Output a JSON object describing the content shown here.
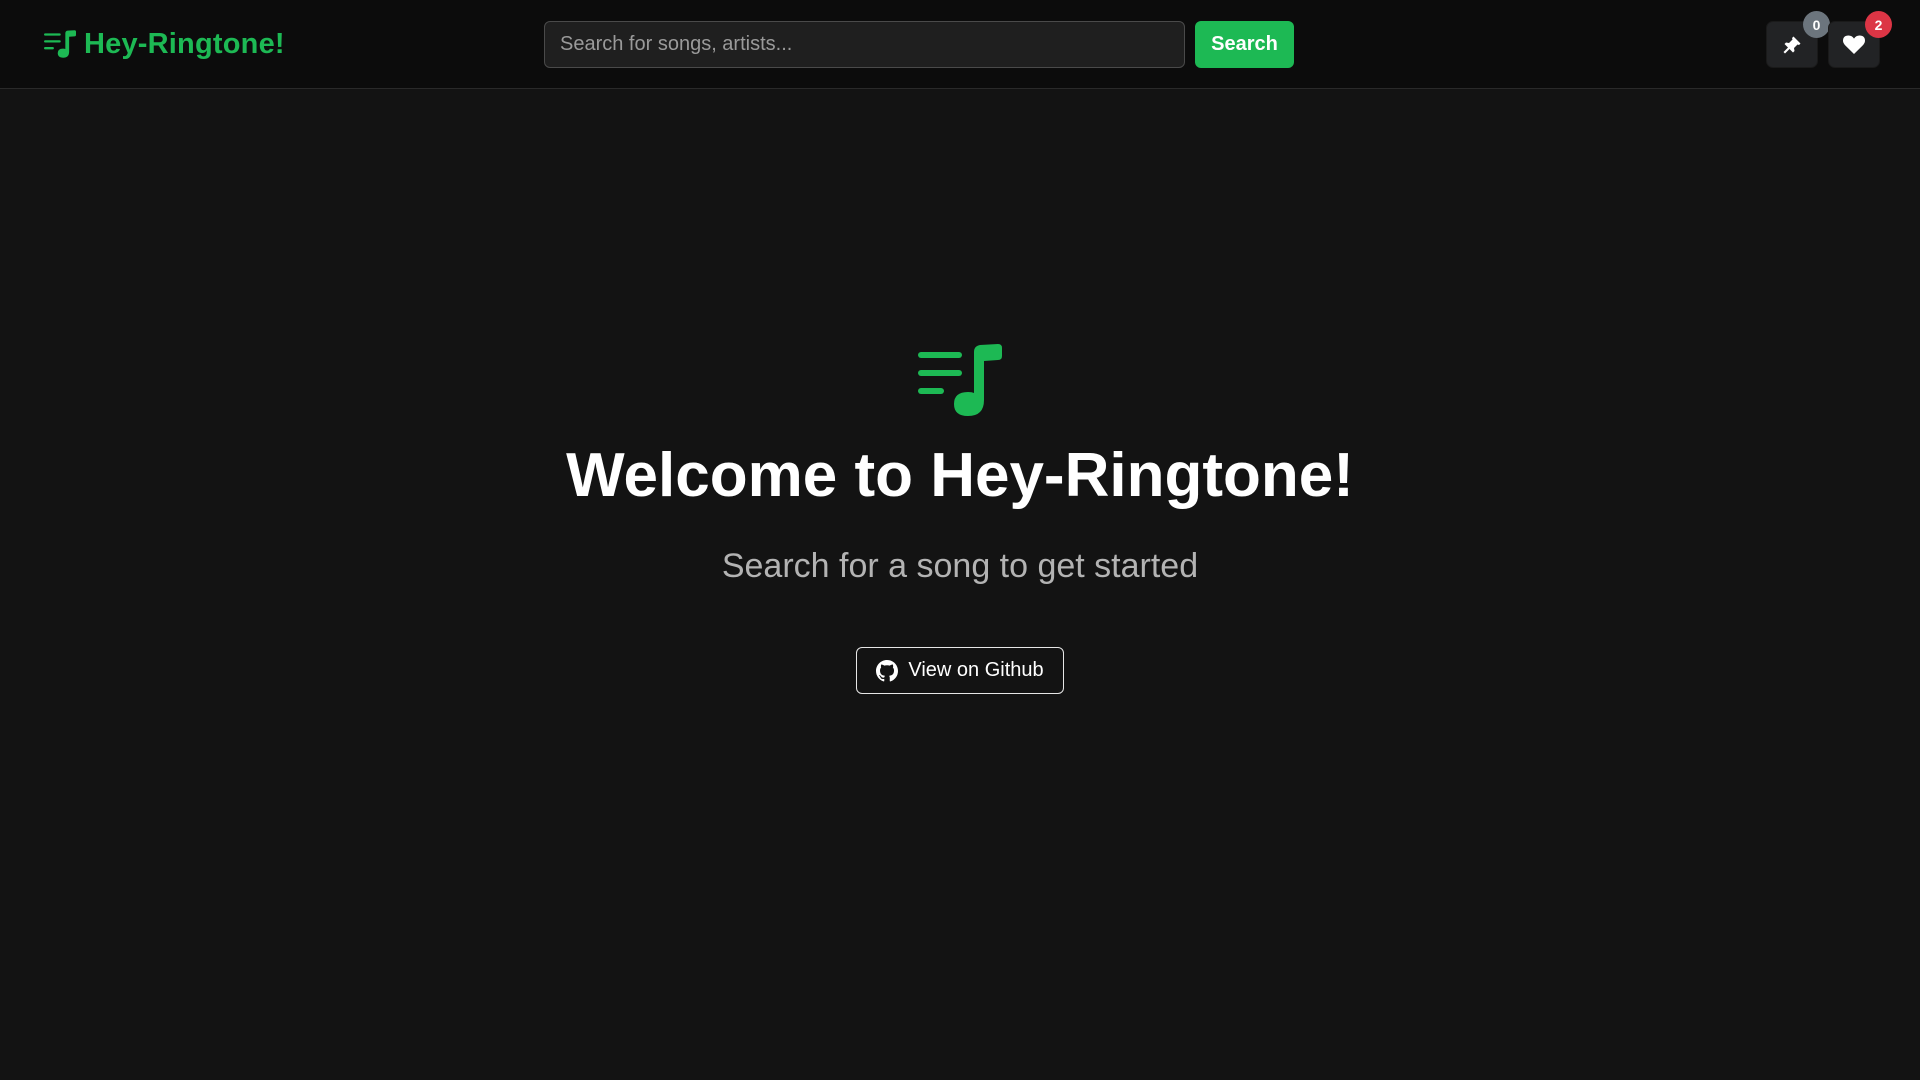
{
  "navbar": {
    "brand": {
      "title": "Hey-Ringtone!",
      "icon": "music-list-icon"
    },
    "search": {
      "placeholder": "Search for songs, artists...",
      "value": "",
      "button_label": "Search"
    },
    "actions": {
      "pinned": {
        "icon": "pin-icon",
        "count": "0"
      },
      "favorites": {
        "icon": "heart-icon",
        "count": "2"
      }
    }
  },
  "hero": {
    "icon": "music-list-icon",
    "title": "Welcome to Hey-Ringtone!",
    "subtitle": "Search for a song to get started",
    "github_button": {
      "icon": "github-icon",
      "label": "View on Github"
    }
  },
  "colors": {
    "accent": "#1db954",
    "background": "#131313",
    "navbar_background": "#0c0c0c",
    "badge_neutral": "#6c757d",
    "badge_danger": "#dc3545"
  }
}
